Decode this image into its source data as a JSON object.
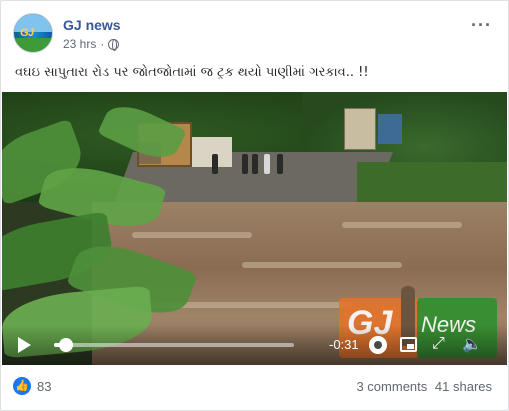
{
  "post": {
    "author": "GJ news",
    "avatar_text": "GJ",
    "time": "23 hrs",
    "privacy_icon": "globe-icon",
    "more_label": "···",
    "text": "વઘઇ સાપુતારા રોડ પર જોતજોતામાં જ ટ્રક થયો પાણીમાં ગરકાવ.. !!"
  },
  "video": {
    "time_remaining": "-0:31",
    "progress": 0.05,
    "overlay_logo_gj": "GJ",
    "overlay_logo_news": "News",
    "icons": {
      "play": "play-icon",
      "settings": "gear-icon",
      "pip": "picture-in-picture-icon",
      "fullscreen": "expand-icon",
      "volume": "volume-icon"
    }
  },
  "footer": {
    "like_icon": "👍",
    "likes": "83",
    "comments": "3 comments",
    "shares": "41 shares"
  },
  "colors": {
    "author": "#385898",
    "like_blue": "#1877f2",
    "muted": "#606770"
  }
}
